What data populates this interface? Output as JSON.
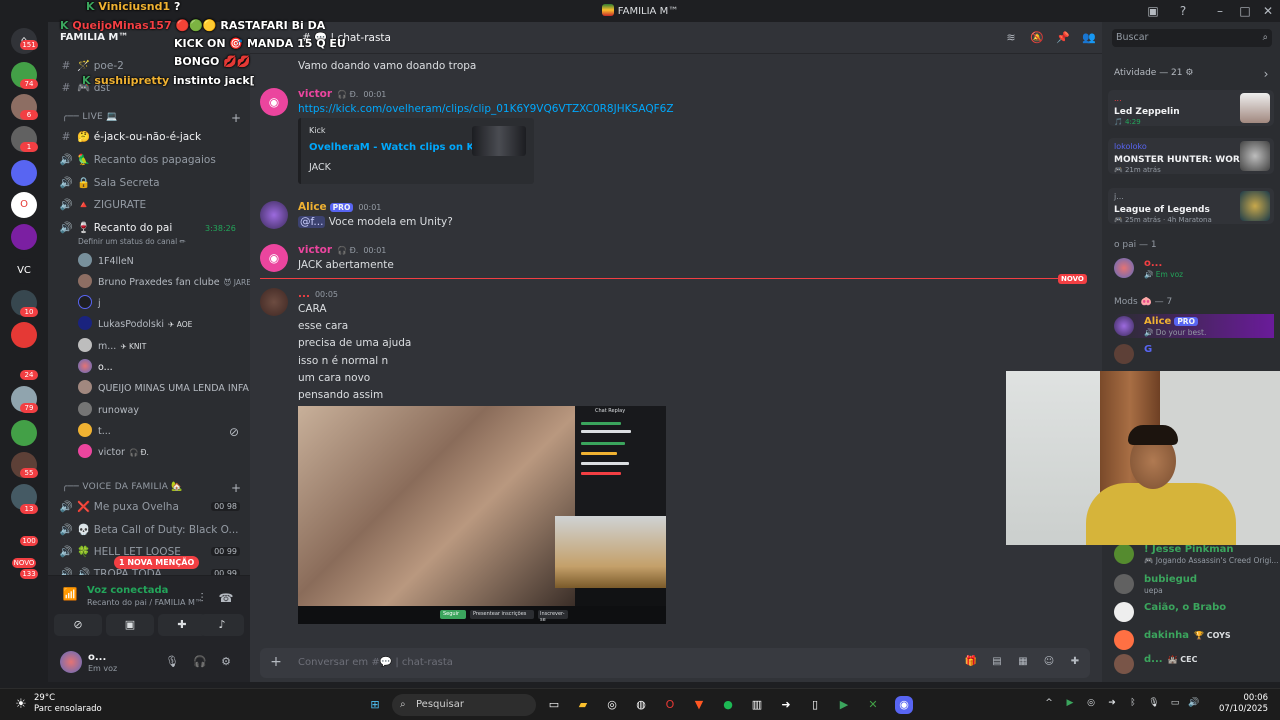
{
  "window": {
    "title": "FAMILIA M™"
  },
  "server": {
    "name": "FAMILIA M™"
  },
  "sidebar": {
    "text_channels": [
      {
        "name": "poe-2",
        "emoji": "🪄"
      },
      {
        "name": "dst",
        "emoji": "🎮"
      }
    ],
    "live_category": "LIVE 💻",
    "live_channels": [
      {
        "sym": "#",
        "name": "é-jack-ou-não-é-jack",
        "emoji": "🤔"
      },
      {
        "sym": "🔊",
        "name": "Recanto dos papagaios",
        "emoji": "🦜"
      },
      {
        "sym": "🔊",
        "name": "Sala Secreta",
        "emoji": "🔒"
      },
      {
        "sym": "🔊",
        "name": "ZIGURATE",
        "emoji": "🔺"
      },
      {
        "sym": "🔊",
        "name": "Recanto do pai",
        "emoji": "🍷",
        "timer": "3:38:26"
      }
    ],
    "status_hint": "Definir um status do canal ✏",
    "voice_users": [
      {
        "name": "1F4lleN",
        "tag": ""
      },
      {
        "name": "Bruno Praxedes fan clube",
        "tag": "😈 JARE"
      },
      {
        "name": "j",
        "tag": ""
      },
      {
        "name": "LukasPodolski",
        "tag": "✈ AOE"
      },
      {
        "name": "m...",
        "tag": "✈ KNIT"
      },
      {
        "name": "o...",
        "tag": ""
      },
      {
        "name": "QUEIJO MINAS UMA LENDA INFA!",
        "tag": ""
      },
      {
        "name": "runoway",
        "tag": ""
      },
      {
        "name": "t...",
        "tag": ""
      },
      {
        "name": "victor",
        "tag": "🎧 Ð."
      }
    ],
    "voice_category": "VOICE DA FAMILIA 🏡",
    "voice_channels": [
      {
        "sym": "❌",
        "name": "Me puxa Ovelha",
        "count": "00 98"
      },
      {
        "sym": "💀",
        "name": "Beta Call of Duty: Black O...",
        "count": ""
      },
      {
        "sym": "🍀",
        "name": "HELL LET LOOSE",
        "count": "00 99"
      },
      {
        "sym": "🔊",
        "name": "TROPA TODA",
        "count": "00 99"
      }
    ],
    "mention_pill": "1 NOVA MENÇÃO"
  },
  "voice_panel": {
    "status": "Voz conectada",
    "location": "Recanto do pai / FAMILIA M™"
  },
  "user_panel": {
    "name": "o...",
    "status": "Em voz"
  },
  "chat": {
    "channel": "chat-rasta",
    "messages": [
      {
        "text": "Vamo doando vamo doando tropa"
      },
      {
        "author": "victor",
        "badge": "🎧 Ð.",
        "time": "00:01",
        "link": "https://kick.com/ovelheram/clips/clip_01K6Y9VQ6VTZXC0R8JHKSAQF6Z",
        "embed": {
          "provider": "Kick",
          "title": "OvelheraM - Watch clips on Kick",
          "desc": "JACK"
        }
      },
      {
        "author": "Alice",
        "badge": "PRO",
        "time": "00:01",
        "mention": "@f...",
        "text": "Voce modela em Unity?"
      },
      {
        "author": "victor",
        "badge": "🎧 Ð.",
        "time": "00:01",
        "text": "JACK abertamente"
      },
      {
        "author": "...",
        "time": "00:05",
        "lines": [
          "CARA",
          "esse cara",
          "precisa de uma ajuda",
          "isso n é normal n",
          "um cara novo",
          "pensando assim"
        ]
      }
    ],
    "new_label": "NOVO",
    "image": {
      "panel_title": "Chat Replay",
      "buttons": [
        "Seguir",
        "Presentear inscrições",
        "Inscrever-se"
      ]
    },
    "composer_placeholder": "Conversar em #💬 | chat-rasta"
  },
  "members": {
    "search_placeholder": "Buscar",
    "activity_header": "Atividade — 21 ⚙",
    "activities": [
      {
        "user": "...",
        "title": "Led Zeppelin",
        "sub": "🎵 4:29"
      },
      {
        "user": "lokoloko",
        "title": "MONSTER HUNTER: WORLD",
        "sub": "🎮 21m atrás"
      },
      {
        "user": "j...",
        "title": "League of Legends",
        "sub": "🎮 25m atrás · 4h Maratona"
      }
    ],
    "group1": "o pai — 1",
    "group1_members": [
      {
        "name": "o...",
        "status": "🔊 Em voz"
      }
    ],
    "group2": "Mods 🐽 — 7",
    "group2_members": [
      {
        "name": "Alice",
        "tag": "PRO",
        "status": "🔊 Do your best."
      },
      {
        "name": "G",
        "status": ""
      }
    ],
    "lower_members": [
      {
        "name": "! Jesse Pinkman",
        "status": "🎮 Jogando Assassin's Creed Origi..."
      },
      {
        "name": "bubiegud",
        "status": "uepa"
      },
      {
        "name": "Caião, o Brabo",
        "status": ""
      },
      {
        "name": "dakinha",
        "tag": "🏆 COYS",
        "status": ""
      },
      {
        "name": "d...",
        "tag": "🏰 CEC",
        "status": ""
      }
    ]
  },
  "overlay": {
    "u1": "Viniciusnd1",
    "m1": "?",
    "u2": "QueijoMinas157",
    "m2": "🔴🟢🟡 RASTAFARI Bi DA",
    "m2b": "KICK ON 🎯 MANDA 15 Q EU",
    "m2c": "BONGO 💋💋",
    "u3": "sushiipretty",
    "m3": "instinto jack["
  },
  "taskbar": {
    "weather_temp": "29°C",
    "weather_desc": "Parc ensolarado",
    "search": "Pesquisar",
    "time": "00:06",
    "date": "07/10/2025"
  },
  "servers": {
    "badges": [
      "151",
      "74",
      "6",
      "1",
      "VC",
      "10",
      "24",
      "79",
      "55",
      "13",
      "100",
      "NOVO",
      "133"
    ]
  }
}
